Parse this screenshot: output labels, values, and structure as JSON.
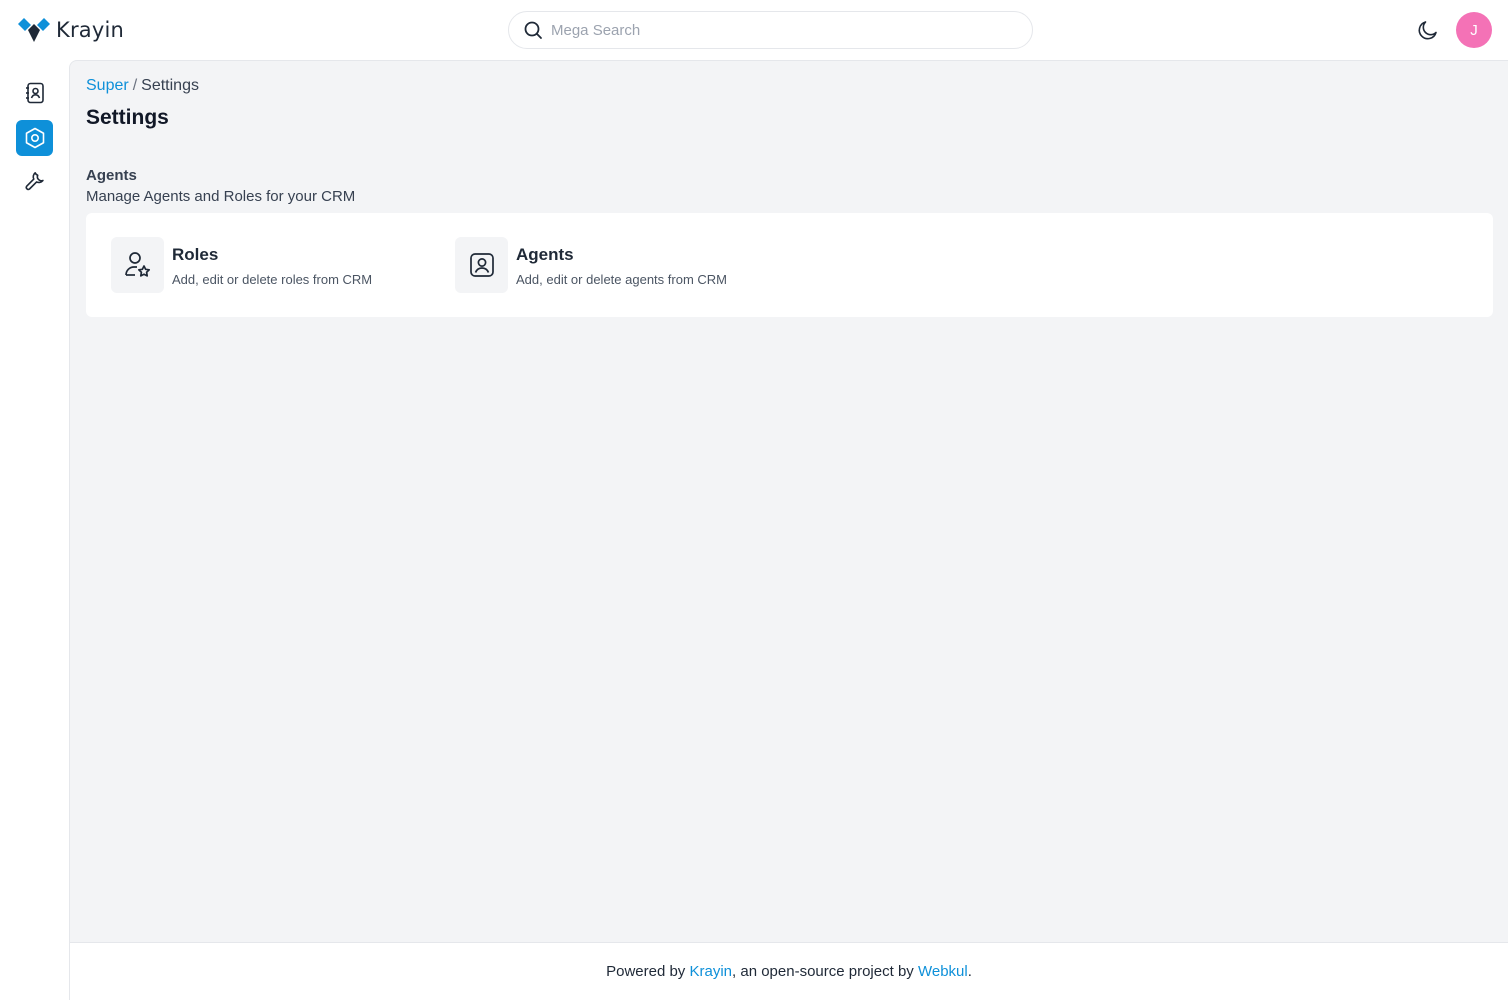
{
  "header": {
    "brand": "Krayin",
    "search": {
      "placeholder": "Mega Search",
      "value": ""
    },
    "theme_toggle_icon": "moon-icon",
    "avatar_initial": "J",
    "avatar_color": "#f472b6"
  },
  "sidebar": {
    "items": [
      {
        "name": "contacts",
        "icon": "contact-book-icon",
        "active": false
      },
      {
        "name": "settings",
        "icon": "settings-icon",
        "active": true
      },
      {
        "name": "configuration",
        "icon": "wrench-icon",
        "active": false
      }
    ]
  },
  "breadcrumb": {
    "root": "Super",
    "separator": "/",
    "current": "Settings"
  },
  "page_title": "Settings",
  "section": {
    "title": "Agents",
    "description": "Manage Agents and Roles for your CRM",
    "items": [
      {
        "title": "Roles",
        "description": "Add, edit or delete roles from CRM",
        "icon": "user-star-icon"
      },
      {
        "title": "Agents",
        "description": "Add, edit or delete agents from CRM",
        "icon": "user-badge-icon"
      }
    ]
  },
  "footer": {
    "prefix": "Powered by ",
    "krayin_link": "Krayin",
    "middle": ", an open-source project by ",
    "webkul_link": "Webkul",
    "suffix": "."
  },
  "colors": {
    "accent": "#0e90d9",
    "background": "#f3f4f6"
  }
}
